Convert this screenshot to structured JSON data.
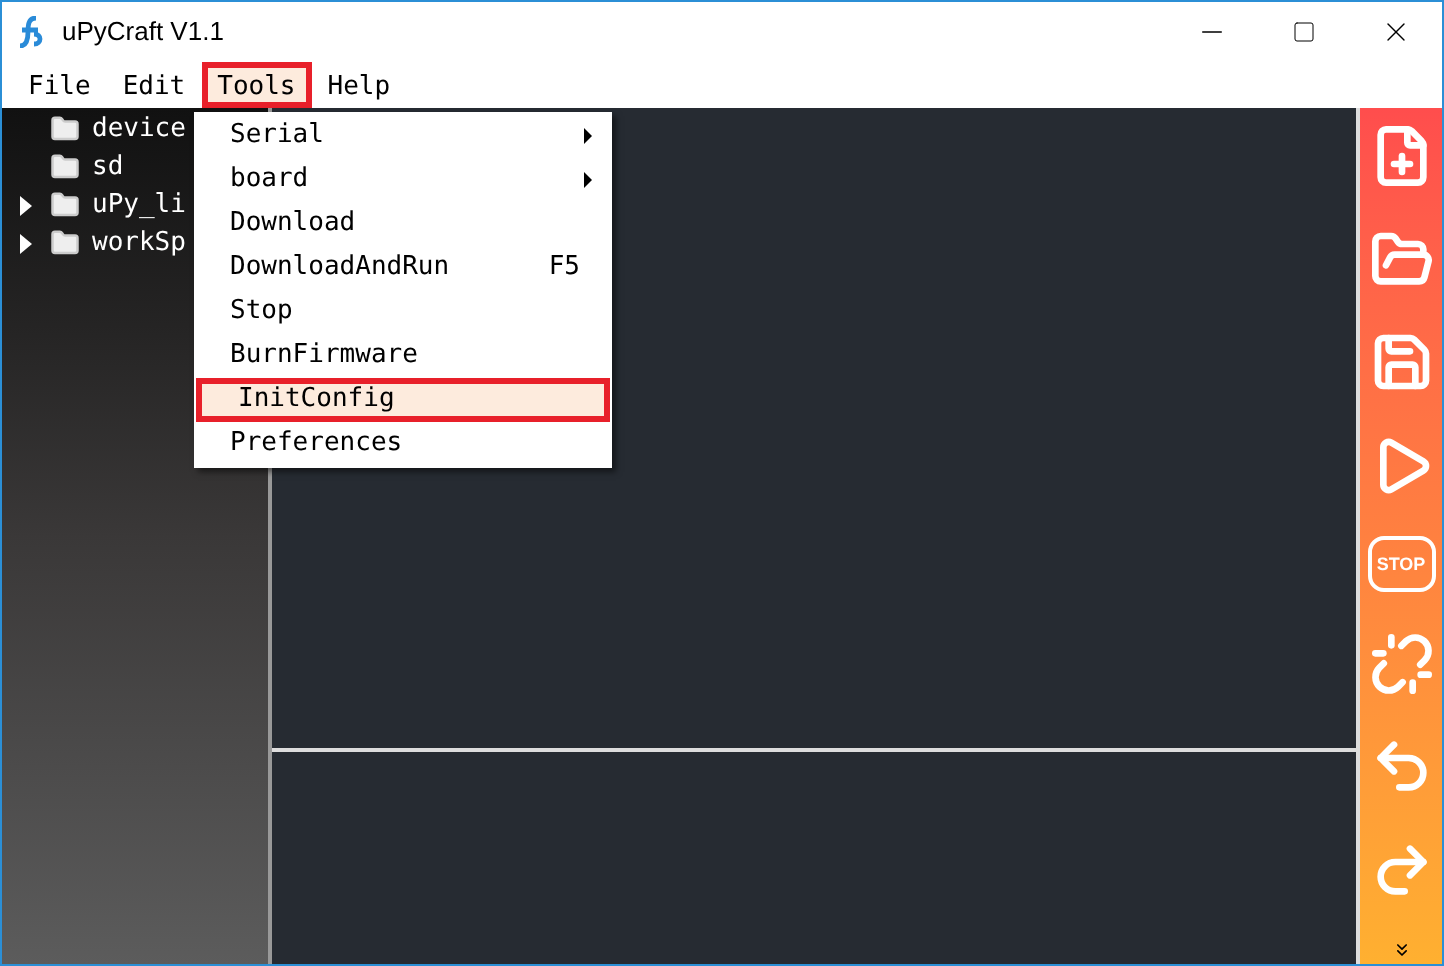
{
  "window": {
    "title": "uPyCraft V1.1"
  },
  "menu_bar": [
    {
      "label": "File",
      "selected": false,
      "highlighted": false
    },
    {
      "label": "Edit",
      "selected": false,
      "highlighted": false
    },
    {
      "label": "Tools",
      "selected": true,
      "highlighted": true
    },
    {
      "label": "Help",
      "selected": false,
      "highlighted": false
    }
  ],
  "tree": [
    {
      "label": "device",
      "expandable": false
    },
    {
      "label": "sd",
      "expandable": false
    },
    {
      "label": "uPy_li",
      "expandable": true
    },
    {
      "label": "workSp",
      "expandable": true
    }
  ],
  "tools_menu": [
    {
      "label": "Serial",
      "submenu": true,
      "highlighted": false
    },
    {
      "label": "board",
      "submenu": true,
      "highlighted": false
    },
    {
      "label": "Download",
      "submenu": false,
      "highlighted": false
    },
    {
      "label": "DownloadAndRun",
      "shortcut": "F5",
      "submenu": false,
      "highlighted": false
    },
    {
      "label": "Stop",
      "submenu": false,
      "highlighted": false
    },
    {
      "label": "BurnFirmware",
      "submenu": false,
      "highlighted": false
    },
    {
      "label": "InitConfig",
      "submenu": false,
      "highlighted": true
    },
    {
      "label": "Preferences",
      "submenu": false,
      "highlighted": false
    }
  ],
  "toolbar": [
    {
      "kind": "new"
    },
    {
      "kind": "open"
    },
    {
      "kind": "save"
    },
    {
      "kind": "run"
    },
    {
      "kind": "stop",
      "label": "STOP"
    },
    {
      "kind": "disconnect"
    },
    {
      "kind": "undo"
    },
    {
      "kind": "redo"
    },
    {
      "kind": "more"
    }
  ]
}
